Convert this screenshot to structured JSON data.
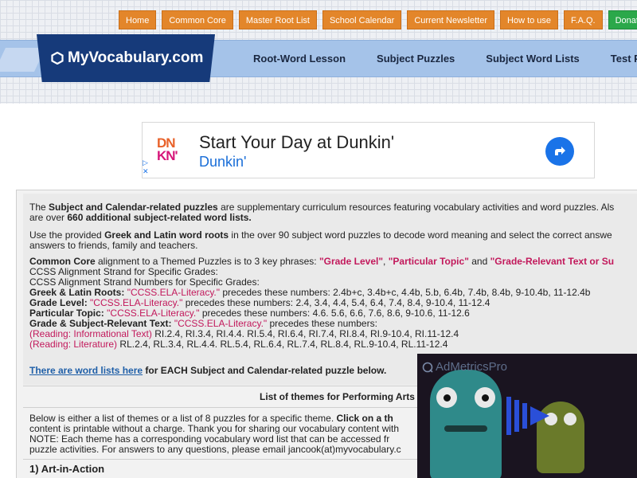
{
  "top_nav": [
    {
      "label": "Home"
    },
    {
      "label": "Common Core"
    },
    {
      "label": "Master Root List"
    },
    {
      "label": "School Calendar"
    },
    {
      "label": "Current Newsletter"
    },
    {
      "label": "How to use"
    },
    {
      "label": "F.A.Q."
    },
    {
      "label": "Donate"
    }
  ],
  "logo_text": "MyVocabulary.com",
  "main_nav": [
    "Root-Word Lesson",
    "Subject Puzzles",
    "Subject Word Lists",
    "Test Pre"
  ],
  "ad": {
    "logo_line1": "DN",
    "logo_line2": "KN'",
    "headline": "Start Your Day at Dunkin'",
    "brand": "Dunkin'"
  },
  "content": {
    "p1_a": "The ",
    "p1_b": "Subject and Calendar-related puzzles",
    "p1_c": " are supplementary curriculum resources featuring vocabulary activities and word puzzles. Als",
    "p1_d": "are over ",
    "p1_e": "660 additional subject-related word lists.",
    "p2_a": "Use the provided ",
    "p2_b": "Greek and Latin word roots",
    "p2_c": " in the over 90 subject word puzzles to decode word meaning and select the correct answe",
    "p2_d": "answers to friends, family and teachers.",
    "cc_a": "Common Core",
    "cc_b": " alignment to a Themed Puzzles is to 3 key phrases: ",
    "cc_c": "\"Grade Level\"",
    "cc_d": ", ",
    "cc_e": "\"Particular Topic\"",
    "cc_f": " and ",
    "cc_g": "\"Grade-Relevant Text or Su",
    "strand1": "CCSS Alignment Strand for Specific Grades:",
    "strand2": "CCSS Alignment Strand Numbers for Specific Grades:",
    "gl_roots_a": "Greek & Latin Roots: ",
    "gl_roots_b": "\"CCSS.ELA-Literacy.\"",
    "gl_roots_c": " precedes these numbers: 2.4b+c, 3.4b+c, 4.4b, 5.b, 6.4b, 7.4b, 8.4b, 9-10.4b, 11-12.4b",
    "grade_a": "Grade Level: ",
    "grade_b": "\"CCSS.ELA-Literacy.\"",
    "grade_c": " precedes these numbers: 2.4, 3.4, 4.4, 5.4, 6.4, 7.4, 8.4, 9-10.4, 11-12.4",
    "topic_a": "Particular Topic: ",
    "topic_b": "\"CCSS.ELA-Literacy.\"",
    "topic_c": " precedes these numbers: 4.6. 5.6, 6.6, 7.6, 8.6, 9-10.6, 11-12.6",
    "grt_a": "Grade & Subject-Relevant Text: ",
    "grt_b": "\"CCSS.ELA-Literacy.\"",
    "grt_c": " precedes these numbers:",
    "ri_a": "(Reading: Informational Text)",
    "ri_b": " RI.2.4, RI.3.4, RI.4.4. RI.5.4, RI.6.4, RI.7.4, RI.8.4, RI.9-10.4, RI.11-12.4",
    "rl_a": "(Reading: Literature)",
    "rl_b": " RL.2.4, RL.3.4, RL.4.4. RL.5.4, RL.6.4, RL.7.4, RL.8.4, RL.9-10.4, RL.11-12.4",
    "wl_link": "There are word lists here",
    "wl_rest": " for EACH Subject and Calendar-related puzzle below.",
    "themes_heading": "List of themes for Performing Arts",
    "b1_a": "Below is either a list of themes or a list of 8 puzzles for a specific theme. ",
    "b1_b": "Click on a th",
    "b2": "content is printable without a charge. Thank you for sharing our vocabulary content with",
    "b3": "NOTE: Each theme has a corresponding vocabulary word list that can be accessed fr",
    "b4": "puzzle activities. For answers to any questions, please email jancook(at)myvocabulary.c",
    "item1": "1) Art-in-Action"
  },
  "video_ad": {
    "brand": "AdMetricsPro"
  }
}
